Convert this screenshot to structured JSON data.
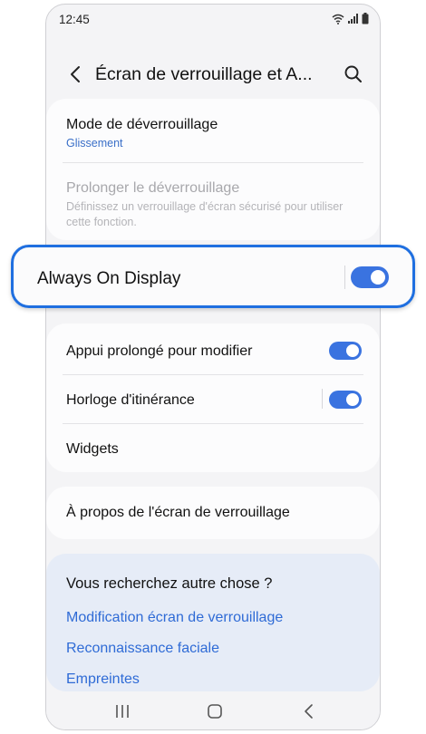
{
  "status_bar": {
    "time": "12:45",
    "icons": [
      "wifi-icon",
      "signal-icon",
      "battery-icon"
    ]
  },
  "header": {
    "title": "Écran de verrouillage et A...",
    "back_icon": "chevron-left-icon",
    "search_icon": "search-icon"
  },
  "security_card": {
    "unlock_mode": {
      "label": "Mode de déverrouillage",
      "value": "Glissement"
    },
    "extend_unlock": {
      "label": "Prolonger le déverrouillage",
      "description_line1": "Définissez un verrouillage d'écran sécurisé pour utiliser",
      "description_line2": "cette fonction.",
      "enabled": false
    }
  },
  "always_on_display": {
    "label": "Always On Display",
    "toggle_on": true
  },
  "options_card": {
    "long_press": {
      "label": "Appui prolongé pour modifier",
      "toggle_on": true
    },
    "roaming_clock": {
      "label": "Horloge d'itinérance",
      "toggle_on": true
    },
    "widgets": {
      "label": "Widgets"
    }
  },
  "about": {
    "label": "À propos de l'écran de verrouillage"
  },
  "suggestions": {
    "heading": "Vous recherchez autre chose ?",
    "links": [
      "Modification écran de verrouillage",
      "Reconnaissance faciale",
      "Empreintes"
    ]
  },
  "nav_bar": {
    "icons": [
      "recents-icon",
      "home-icon",
      "back-icon"
    ]
  },
  "colors": {
    "accent": "#3a73e0",
    "link": "#2f6bd6",
    "highlight_border": "#1f6fe0",
    "screen_bg": "#f4f4f6"
  }
}
